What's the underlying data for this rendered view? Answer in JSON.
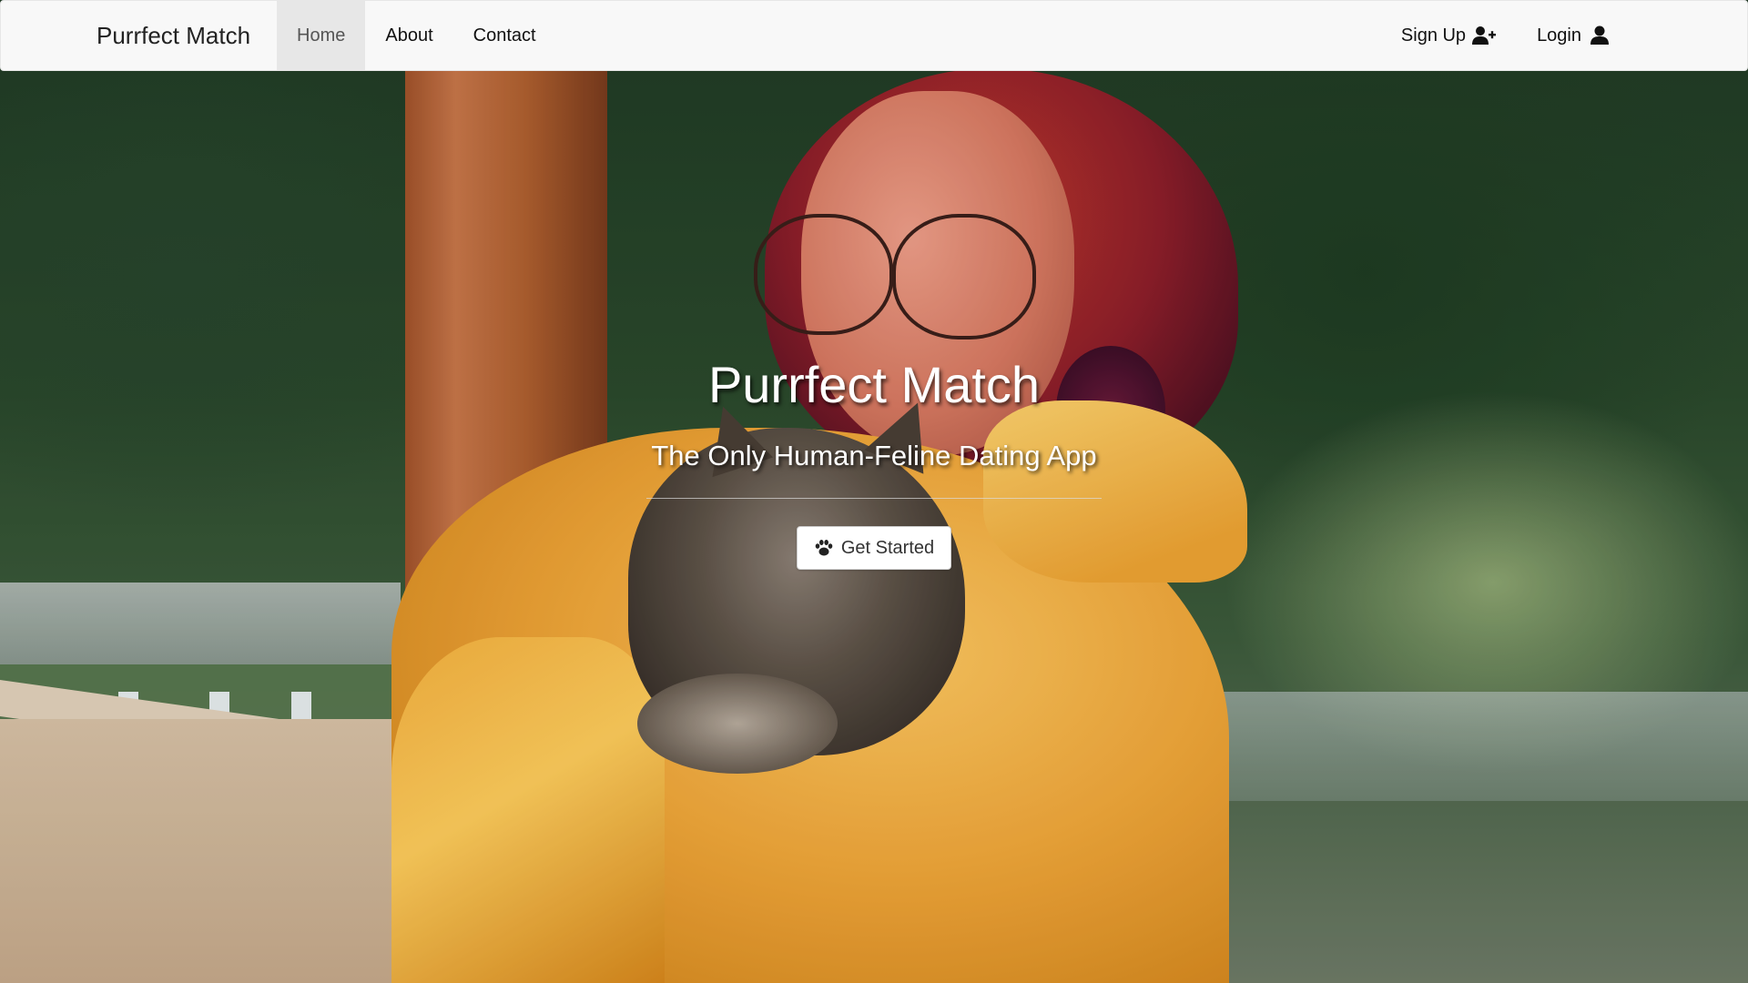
{
  "navbar": {
    "brand": "Purrfect Match",
    "links": [
      {
        "label": "Home",
        "active": true
      },
      {
        "label": "About",
        "active": false
      },
      {
        "label": "Contact",
        "active": false
      }
    ],
    "right_links": [
      {
        "label": "Sign Up",
        "icon": "user-plus-icon"
      },
      {
        "label": "Login",
        "icon": "user-icon"
      }
    ]
  },
  "hero": {
    "title": "Purrfect Match",
    "subtitle": "The Only Human-Feline Dating App",
    "cta_label": "Get Started",
    "cta_icon": "paw-icon",
    "background": "woman-with-glasses-holding-cat-photo"
  },
  "colors": {
    "navbar_bg": "#f8f8f8",
    "active_tab_bg": "#e7e7e7",
    "text_dark": "#222222",
    "hero_text": "#ffffff",
    "button_bg": "#ffffff"
  }
}
